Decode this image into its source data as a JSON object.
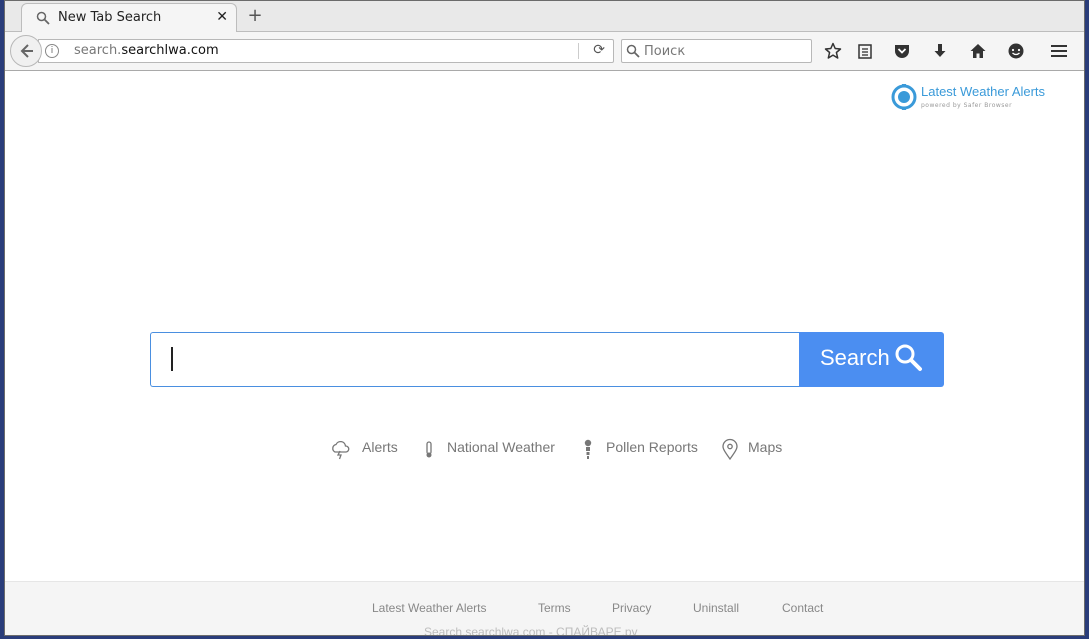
{
  "browser": {
    "tab": {
      "title": "New Tab Search",
      "close": "✕"
    },
    "newtab_label": "+",
    "url": {
      "prefix": "search.",
      "domain": "searchlwa.com"
    },
    "search": {
      "placeholder": "Поиск"
    },
    "toolbar_icons": [
      "star-icon",
      "reading-list-icon",
      "pocket-icon",
      "download-icon",
      "home-icon",
      "chat-icon",
      "menu-icon"
    ]
  },
  "page": {
    "logo": {
      "title": "Latest Weather Alerts",
      "subtitle": "powered by Safer Browser"
    },
    "search": {
      "value": "",
      "button_label": "Search"
    },
    "quicklinks": [
      {
        "label": "Alerts",
        "icon": "cloud-lightning-icon"
      },
      {
        "label": "National Weather",
        "icon": "thermometer-icon"
      },
      {
        "label": "Pollen Reports",
        "icon": "pollen-icon"
      },
      {
        "label": "Maps",
        "icon": "map-pin-icon"
      }
    ],
    "footer": {
      "links": [
        "Latest Weather Alerts",
        "Terms",
        "Privacy",
        "Uninstall",
        "Contact"
      ],
      "watermark": "Search.searchlwa.com - СПАЙВАРЕ.ру"
    }
  },
  "colors": {
    "accent": "#4b8ef1",
    "logo": "#3a9ad9",
    "desktop": "#2a3d7a"
  }
}
